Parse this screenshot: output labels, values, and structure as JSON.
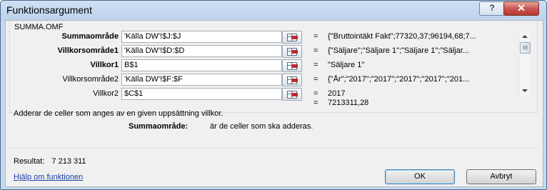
{
  "window": {
    "title": "Funktionsargument",
    "help_glyph": "?",
    "close_glyph": "✕"
  },
  "function_name": "SUMMA.OMF",
  "arguments": [
    {
      "label": "Summaområde",
      "bold": true,
      "input": "'Källa DW'!$J:$J",
      "equals": "=",
      "value": "{\"Bruttointäkt Fakt\";77320,37;96194,68;7..."
    },
    {
      "label": "Villkorsområde1",
      "bold": true,
      "input": "'Källa DW'!$D:$D",
      "equals": "=",
      "value": "{\"Säljare\";\"Säljare 1\";\"Säljare 1\";\"Säljar..."
    },
    {
      "label": "Villkor1",
      "bold": true,
      "input": "B$1",
      "equals": "=",
      "value": "\"Säljare 1\""
    },
    {
      "label": "Villkorsområde2",
      "bold": false,
      "input": "'Källa DW'!$F:$F",
      "equals": "=",
      "value": "{\"År\";\"2017\";\"2017\";\"2017\";\"2017\";\"201..."
    },
    {
      "label": "Villkor2",
      "bold": false,
      "input": "$C$1",
      "equals": "=",
      "value": "2017"
    }
  ],
  "formula_result": {
    "equals": "=",
    "value": "7213311,28"
  },
  "description": "Adderar de celler som anges av en given uppsättning villkor.",
  "parameter_help": {
    "name": "Summaområde:",
    "text": "är de celler som ska adderas."
  },
  "result": {
    "label": "Resultat:",
    "value": "7 213 311"
  },
  "help_link": "Hjälp om funktionen",
  "buttons": {
    "ok": "OK",
    "cancel": "Avbryt"
  },
  "colors": {
    "link": "#1a3fa6",
    "title_bar": "#bcd2ec",
    "close_button": "#c75050"
  }
}
